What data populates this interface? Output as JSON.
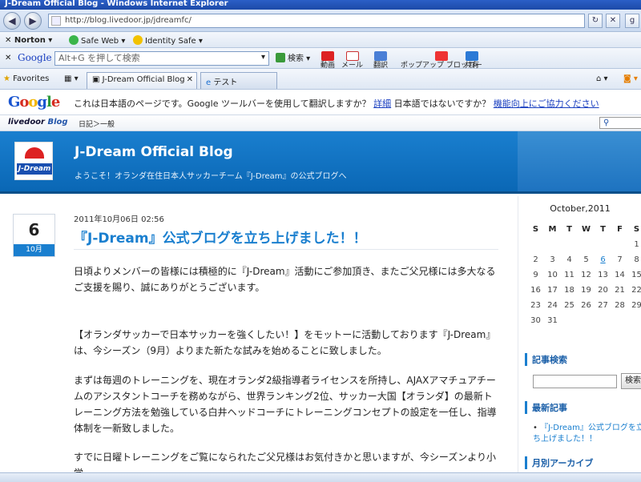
{
  "window": {
    "title": "J-Dream Official Blog - Windows Internet Explorer"
  },
  "address": {
    "url": "http://blog.livedoor.jp/jdreamfc/"
  },
  "norton": {
    "brand": "Norton",
    "safeweb": "Safe Web",
    "identity": "Identity Safe"
  },
  "google_toolbar": {
    "brand": "Google",
    "search_placeholder": "Alt+G を押して検索",
    "search_label": "検索",
    "buttons": [
      "動画",
      "メール",
      "翻訳",
      "ポップアップ ブロッカー",
      "共有"
    ]
  },
  "favorites": {
    "label": "Favorites",
    "tabs": [
      "J-Dream Official Blog",
      "テスト"
    ]
  },
  "translate_bar": {
    "logo": "Google",
    "message": "これは日本語のページです。Google ツールバーを使用して翻訳しますか？",
    "details_link": "詳細",
    "not_japanese": "日本語ではないですか？",
    "improve_link": "機能向上にご協力ください"
  },
  "livedoor": {
    "logo": "livedoor",
    "logo_sub": "Blog",
    "breadcrumb": "日記＞一般"
  },
  "blog": {
    "icon_text": "J-Dream",
    "title": "J-Dream Official Blog",
    "subtitle": "ようこそ！オランダ在住日本人サッカーチーム『J-Dream』の公式ブログへ"
  },
  "post": {
    "day": "6",
    "month": "10月",
    "datetime": "2011年10月06日 02:56",
    "title": "『J-Dream』公式ブログを立ち上げました！！",
    "paragraphs": [
      "日頃よりメンバーの皆様には積極的に『J-Dream』活動にご参加頂き、またご父兄様には多大なるご支援を賜り、誠にありがとうございます。",
      "【オランダサッカーで日本サッカーを強くしたい！】をモットーに活動しております『J-Dream』は、今シーズン（9月）よりまた新たな試みを始めることに致しました。",
      "まずは毎週のトレーニングを、現在オランダ2級指導者ライセンスを所持し、AJAXアマチュアチームのアシスタントコーチを務めながら、世界ランキング2位、サッカー大国【オランダ】の最新トレーニング方法を勉強している白井ヘッドコーチにトレーニングコンセプトの設定を一任し、指導体制を一新致しました。",
      "すでに日曜トレーニングをご覧になられたご父兄様はお気付きかと思いますが、今シーズンより小学"
    ]
  },
  "sidebar": {
    "calendar": {
      "title": "October,2011",
      "weekdays": [
        "S",
        "M",
        "T",
        "W",
        "T",
        "F",
        "S"
      ],
      "rows": [
        [
          "",
          "",
          "",
          "",
          "",
          "",
          "1"
        ],
        [
          "2",
          "3",
          "4",
          "5",
          "6",
          "7",
          "8"
        ],
        [
          "9",
          "10",
          "11",
          "12",
          "13",
          "14",
          "15"
        ],
        [
          "16",
          "17",
          "18",
          "19",
          "20",
          "21",
          "22"
        ],
        [
          "23",
          "24",
          "25",
          "26",
          "27",
          "28",
          "29"
        ],
        [
          "30",
          "31",
          "",
          "",
          "",
          "",
          ""
        ]
      ],
      "linked_day": "6"
    },
    "search_heading": "記事検索",
    "search_button": "検索",
    "recent_heading": "最新記事",
    "recent_item": "『J-Dream』公式ブログを立ち上げました！！",
    "archive_heading": "月別アーカイブ"
  }
}
